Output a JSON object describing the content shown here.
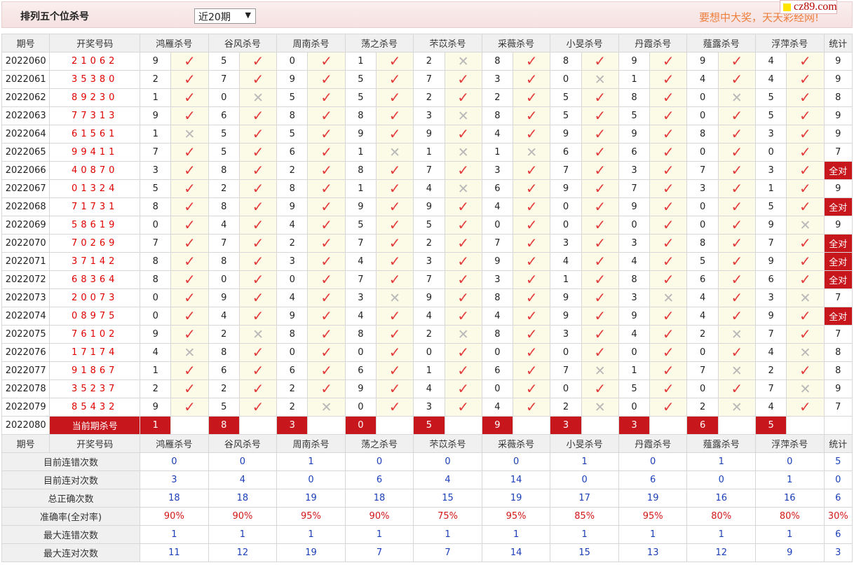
{
  "header": {
    "title": "排列五个位杀号",
    "period_select": "近20期",
    "slogan": "要想中大奖，天天彩经网!",
    "logo": "cz89.com"
  },
  "columns": [
    "期号",
    "开奖号码",
    "鸿雁杀号",
    "谷风杀号",
    "周南杀号",
    "荡之杀号",
    "芣苡杀号",
    "采薇杀号",
    "小旻杀号",
    "丹霞杀号",
    "薤露杀号",
    "浮萍杀号",
    "统计"
  ],
  "rows": [
    {
      "issue": "2022060",
      "draw": "21062",
      "kills": [
        [
          9,
          1
        ],
        [
          5,
          1
        ],
        [
          0,
          1
        ],
        [
          1,
          1
        ],
        [
          2,
          0
        ],
        [
          8,
          1
        ],
        [
          8,
          1
        ],
        [
          9,
          1
        ],
        [
          9,
          1
        ],
        [
          4,
          1
        ]
      ],
      "stat": "9"
    },
    {
      "issue": "2022061",
      "draw": "35380",
      "kills": [
        [
          2,
          1
        ],
        [
          7,
          1
        ],
        [
          9,
          1
        ],
        [
          5,
          1
        ],
        [
          7,
          1
        ],
        [
          3,
          1
        ],
        [
          0,
          0
        ],
        [
          1,
          1
        ],
        [
          4,
          1
        ],
        [
          4,
          1
        ]
      ],
      "stat": "9"
    },
    {
      "issue": "2022062",
      "draw": "89230",
      "kills": [
        [
          1,
          1
        ],
        [
          0,
          0
        ],
        [
          5,
          1
        ],
        [
          5,
          1
        ],
        [
          2,
          1
        ],
        [
          2,
          1
        ],
        [
          5,
          1
        ],
        [
          8,
          1
        ],
        [
          0,
          0
        ],
        [
          5,
          1
        ]
      ],
      "stat": "8"
    },
    {
      "issue": "2022063",
      "draw": "77313",
      "kills": [
        [
          9,
          1
        ],
        [
          6,
          1
        ],
        [
          8,
          1
        ],
        [
          8,
          1
        ],
        [
          3,
          0
        ],
        [
          8,
          1
        ],
        [
          5,
          1
        ],
        [
          5,
          1
        ],
        [
          0,
          1
        ],
        [
          5,
          1
        ]
      ],
      "stat": "9"
    },
    {
      "issue": "2022064",
      "draw": "61561",
      "kills": [
        [
          1,
          0
        ],
        [
          5,
          1
        ],
        [
          5,
          1
        ],
        [
          9,
          1
        ],
        [
          9,
          1
        ],
        [
          4,
          1
        ],
        [
          9,
          1
        ],
        [
          9,
          1
        ],
        [
          8,
          1
        ],
        [
          3,
          1
        ]
      ],
      "stat": "9"
    },
    {
      "issue": "2022065",
      "draw": "99411",
      "kills": [
        [
          7,
          1
        ],
        [
          5,
          1
        ],
        [
          6,
          1
        ],
        [
          1,
          0
        ],
        [
          1,
          0
        ],
        [
          1,
          0
        ],
        [
          6,
          1
        ],
        [
          6,
          1
        ],
        [
          0,
          1
        ],
        [
          0,
          1
        ]
      ],
      "stat": "7"
    },
    {
      "issue": "2022066",
      "draw": "40870",
      "kills": [
        [
          3,
          1
        ],
        [
          8,
          1
        ],
        [
          2,
          1
        ],
        [
          8,
          1
        ],
        [
          7,
          1
        ],
        [
          3,
          1
        ],
        [
          7,
          1
        ],
        [
          3,
          1
        ],
        [
          7,
          1
        ],
        [
          3,
          1
        ]
      ],
      "stat": "全对"
    },
    {
      "issue": "2022067",
      "draw": "01324",
      "kills": [
        [
          5,
          1
        ],
        [
          2,
          1
        ],
        [
          8,
          1
        ],
        [
          1,
          1
        ],
        [
          4,
          0
        ],
        [
          6,
          1
        ],
        [
          9,
          1
        ],
        [
          7,
          1
        ],
        [
          3,
          1
        ],
        [
          1,
          1
        ]
      ],
      "stat": "9"
    },
    {
      "issue": "2022068",
      "draw": "71731",
      "kills": [
        [
          8,
          1
        ],
        [
          8,
          1
        ],
        [
          9,
          1
        ],
        [
          9,
          1
        ],
        [
          9,
          1
        ],
        [
          4,
          1
        ],
        [
          0,
          1
        ],
        [
          9,
          1
        ],
        [
          0,
          1
        ],
        [
          5,
          1
        ]
      ],
      "stat": "全对"
    },
    {
      "issue": "2022069",
      "draw": "58619",
      "kills": [
        [
          0,
          1
        ],
        [
          4,
          1
        ],
        [
          4,
          1
        ],
        [
          5,
          1
        ],
        [
          5,
          1
        ],
        [
          0,
          1
        ],
        [
          0,
          1
        ],
        [
          0,
          1
        ],
        [
          0,
          1
        ],
        [
          9,
          0
        ]
      ],
      "stat": "9"
    },
    {
      "issue": "2022070",
      "draw": "70269",
      "kills": [
        [
          7,
          1
        ],
        [
          7,
          1
        ],
        [
          2,
          1
        ],
        [
          7,
          1
        ],
        [
          2,
          1
        ],
        [
          7,
          1
        ],
        [
          3,
          1
        ],
        [
          3,
          1
        ],
        [
          8,
          1
        ],
        [
          7,
          1
        ]
      ],
      "stat": "全对"
    },
    {
      "issue": "2022071",
      "draw": "37142",
      "kills": [
        [
          8,
          1
        ],
        [
          8,
          1
        ],
        [
          3,
          1
        ],
        [
          4,
          1
        ],
        [
          3,
          1
        ],
        [
          9,
          1
        ],
        [
          4,
          1
        ],
        [
          4,
          1
        ],
        [
          5,
          1
        ],
        [
          9,
          1
        ]
      ],
      "stat": "全对"
    },
    {
      "issue": "2022072",
      "draw": "68364",
      "kills": [
        [
          8,
          1
        ],
        [
          0,
          1
        ],
        [
          0,
          1
        ],
        [
          7,
          1
        ],
        [
          7,
          1
        ],
        [
          3,
          1
        ],
        [
          1,
          1
        ],
        [
          8,
          1
        ],
        [
          6,
          1
        ],
        [
          6,
          1
        ]
      ],
      "stat": "全对"
    },
    {
      "issue": "2022073",
      "draw": "20073",
      "kills": [
        [
          0,
          1
        ],
        [
          9,
          1
        ],
        [
          4,
          1
        ],
        [
          3,
          0
        ],
        [
          9,
          1
        ],
        [
          8,
          1
        ],
        [
          9,
          1
        ],
        [
          3,
          0
        ],
        [
          4,
          1
        ],
        [
          3,
          0
        ]
      ],
      "stat": "7"
    },
    {
      "issue": "2022074",
      "draw": "08975",
      "kills": [
        [
          0,
          1
        ],
        [
          4,
          1
        ],
        [
          9,
          1
        ],
        [
          4,
          1
        ],
        [
          4,
          1
        ],
        [
          4,
          1
        ],
        [
          9,
          1
        ],
        [
          9,
          1
        ],
        [
          4,
          1
        ],
        [
          9,
          1
        ]
      ],
      "stat": "全对"
    },
    {
      "issue": "2022075",
      "draw": "76102",
      "kills": [
        [
          9,
          1
        ],
        [
          2,
          0
        ],
        [
          8,
          1
        ],
        [
          8,
          1
        ],
        [
          2,
          0
        ],
        [
          8,
          1
        ],
        [
          3,
          1
        ],
        [
          4,
          1
        ],
        [
          2,
          0
        ],
        [
          7,
          1
        ]
      ],
      "stat": "7"
    },
    {
      "issue": "2022076",
      "draw": "17174",
      "kills": [
        [
          4,
          0
        ],
        [
          8,
          1
        ],
        [
          0,
          1
        ],
        [
          0,
          1
        ],
        [
          0,
          1
        ],
        [
          0,
          1
        ],
        [
          0,
          1
        ],
        [
          0,
          1
        ],
        [
          0,
          1
        ],
        [
          4,
          0
        ]
      ],
      "stat": "8"
    },
    {
      "issue": "2022077",
      "draw": "91867",
      "kills": [
        [
          1,
          1
        ],
        [
          6,
          1
        ],
        [
          6,
          1
        ],
        [
          6,
          1
        ],
        [
          1,
          1
        ],
        [
          6,
          1
        ],
        [
          7,
          0
        ],
        [
          1,
          1
        ],
        [
          7,
          0
        ],
        [
          2,
          1
        ]
      ],
      "stat": "8"
    },
    {
      "issue": "2022078",
      "draw": "35237",
      "kills": [
        [
          2,
          1
        ],
        [
          2,
          1
        ],
        [
          2,
          1
        ],
        [
          9,
          1
        ],
        [
          4,
          1
        ],
        [
          0,
          1
        ],
        [
          0,
          1
        ],
        [
          5,
          1
        ],
        [
          0,
          1
        ],
        [
          7,
          0
        ]
      ],
      "stat": "9"
    },
    {
      "issue": "2022079",
      "draw": "85432",
      "kills": [
        [
          9,
          1
        ],
        [
          5,
          1
        ],
        [
          2,
          0
        ],
        [
          0,
          1
        ],
        [
          3,
          1
        ],
        [
          4,
          1
        ],
        [
          2,
          0
        ],
        [
          0,
          1
        ],
        [
          2,
          0
        ],
        [
          4,
          1
        ]
      ],
      "stat": "7"
    }
  ],
  "current": {
    "issue": "2022080",
    "label": "当前期杀号",
    "kills": [
      "1",
      "8",
      "3",
      "0",
      "5",
      "9",
      "3",
      "3",
      "6",
      "5"
    ]
  },
  "summary": [
    {
      "label": "目前连错次数",
      "values": [
        "0",
        "0",
        "1",
        "0",
        "0",
        "0",
        "1",
        "0",
        "1",
        "0"
      ],
      "stat": "5",
      "color": "blue"
    },
    {
      "label": "目前连对次数",
      "values": [
        "3",
        "4",
        "0",
        "6",
        "4",
        "14",
        "0",
        "6",
        "0",
        "1"
      ],
      "stat": "0",
      "color": "blue"
    },
    {
      "label": "总正确次数",
      "values": [
        "18",
        "18",
        "19",
        "18",
        "15",
        "19",
        "17",
        "19",
        "16",
        "16"
      ],
      "stat": "6",
      "color": "blue"
    },
    {
      "label": "准确率(全对率)",
      "values": [
        "90%",
        "90%",
        "95%",
        "90%",
        "75%",
        "95%",
        "85%",
        "95%",
        "80%",
        "80%"
      ],
      "stat": "30%",
      "color": "red"
    },
    {
      "label": "最大连错次数",
      "values": [
        "1",
        "1",
        "1",
        "1",
        "1",
        "1",
        "1",
        "1",
        "1",
        "1"
      ],
      "stat": "6",
      "color": "blue"
    },
    {
      "label": "最大连对次数",
      "values": [
        "11",
        "12",
        "19",
        "7",
        "7",
        "14",
        "15",
        "13",
        "12",
        "9"
      ],
      "stat": "3",
      "color": "blue"
    }
  ],
  "icons": {
    "correct": "check-mark-icon",
    "wrong": "cross-mark-icon"
  },
  "colors": {
    "accent_red": "#c8161d",
    "draw_red": "#e00000",
    "blue_value": "#1a3fb8",
    "slogan": "#ee7e3c"
  }
}
